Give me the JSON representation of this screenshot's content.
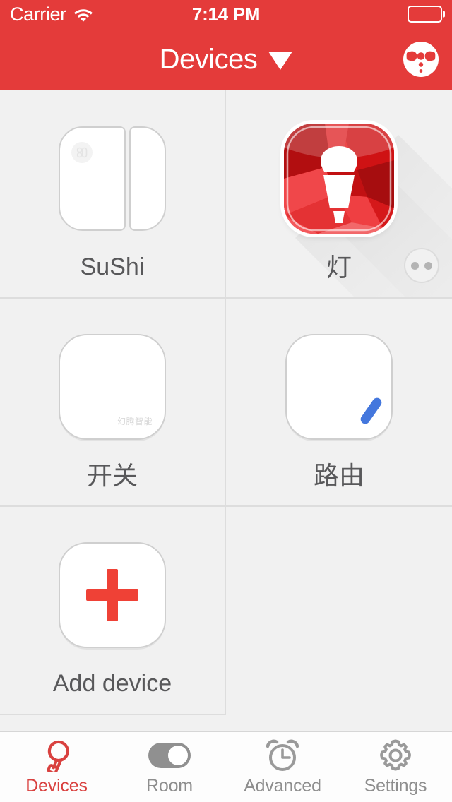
{
  "status_bar": {
    "carrier": "Carrier",
    "wifi_icon": "wifi-icon",
    "time": "7:14 PM",
    "battery_icon": "battery-full-icon"
  },
  "nav_bar": {
    "title": "Devices",
    "caret_icon": "chevron-down-icon",
    "logo_icon": "bowtie-logo-icon",
    "background_color": "#e43b3a"
  },
  "devices": [
    {
      "name": "SuShi",
      "icon": "door-sensor-icon",
      "kind": "sensor",
      "has_more_badge": false
    },
    {
      "name": "灯",
      "icon": "light-bulb-icon",
      "kind": "lamp",
      "has_more_badge": true,
      "more_badge_icon": "more-dots-icon",
      "accent_color": "#e8191b"
    },
    {
      "name": "开关",
      "icon": "switch-icon",
      "kind": "switch",
      "brand_text": "幻腾智能",
      "has_more_badge": false
    },
    {
      "name": "路由",
      "icon": "router-icon",
      "kind": "router",
      "accent_color": "#4477dd",
      "has_more_badge": false
    },
    {
      "name": "Add device",
      "icon": "plus-icon",
      "kind": "add",
      "accent_color": "#ef4136",
      "has_more_badge": false
    }
  ],
  "tab_bar": {
    "active_color": "#d9413f",
    "inactive_color": "#8e8e8e",
    "tabs": [
      {
        "label": "Devices",
        "icon": "bulb-outline-icon",
        "active": true
      },
      {
        "label": "Room",
        "icon": "toggle-switch-icon",
        "active": false
      },
      {
        "label": "Advanced",
        "icon": "alarm-clock-icon",
        "active": false
      },
      {
        "label": "Settings",
        "icon": "gear-icon",
        "active": false
      }
    ]
  }
}
